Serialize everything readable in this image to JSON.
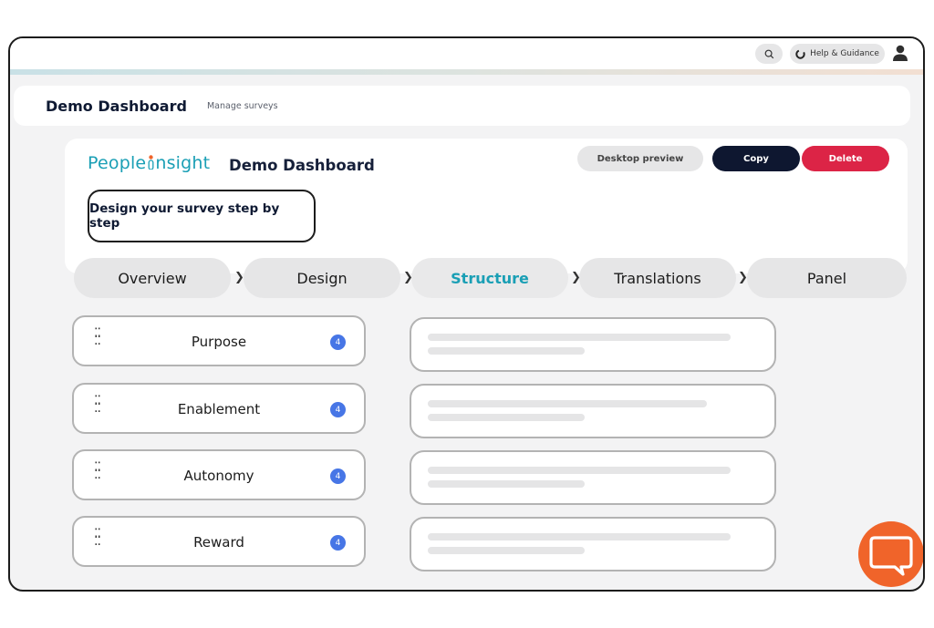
{
  "topbar": {
    "help_label": "Help & Guidance"
  },
  "header": {
    "title": "Demo Dashboard",
    "subtitle": "Manage surveys"
  },
  "card": {
    "logo_prefix": "People",
    "logo_suffix": "nsight",
    "title": "Demo Dashboard",
    "preview_label": "Desktop preview",
    "copy_label": "Copy",
    "delete_label": "Delete",
    "step_label": "Design your survey step by step"
  },
  "tabs": [
    {
      "label": "Overview",
      "active": false
    },
    {
      "label": "Design",
      "active": false
    },
    {
      "label": "Structure",
      "active": true
    },
    {
      "label": "Translations",
      "active": false
    },
    {
      "label": "Panel",
      "active": false
    }
  ],
  "items": [
    {
      "label": "Purpose",
      "count": "4"
    },
    {
      "label": "Enablement",
      "count": "4"
    },
    {
      "label": "Autonomy",
      "count": "4"
    },
    {
      "label": "Reward",
      "count": "4"
    }
  ],
  "colors": {
    "brand_teal": "#1a9fb5",
    "copy_button": "#0e1730",
    "delete_button": "#dc2446",
    "badge": "#4776e6",
    "chat_button": "#f0642a"
  }
}
